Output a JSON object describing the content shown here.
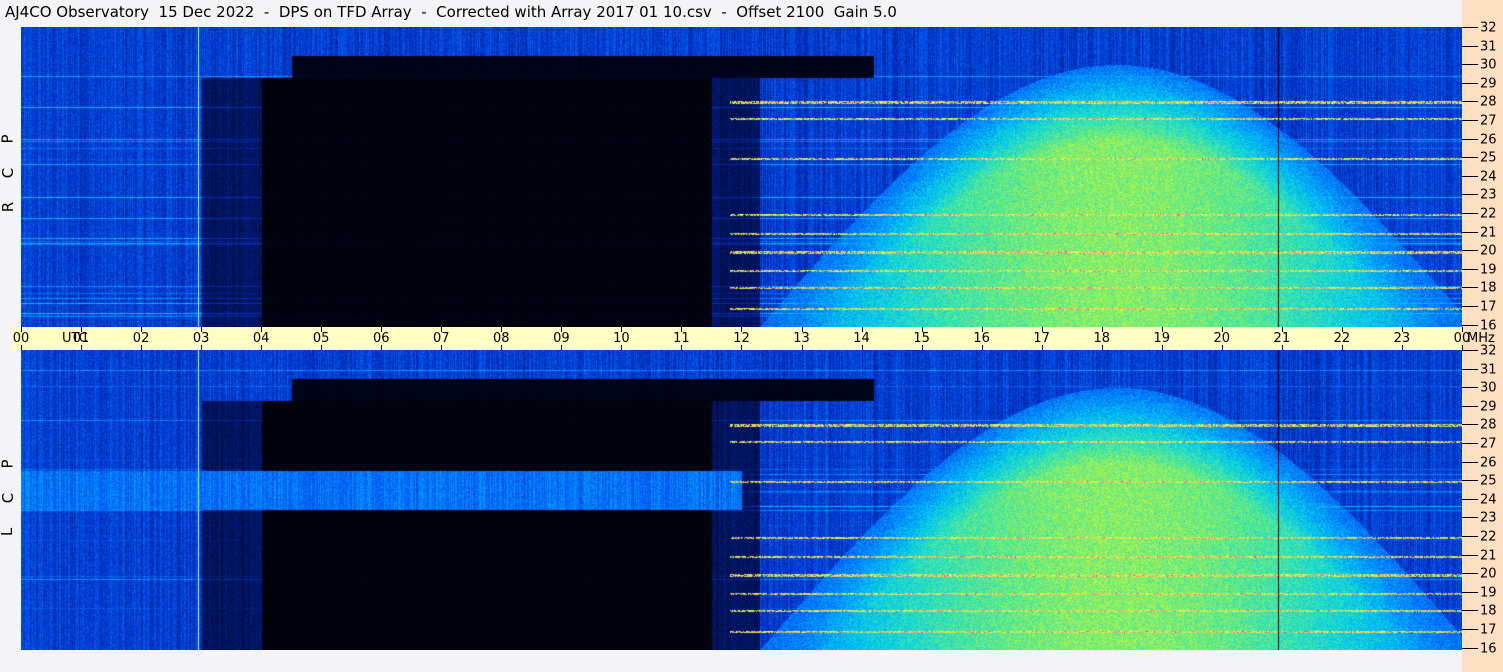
{
  "title": "AJ4CO Observatory  15 Dec 2022  -  DPS on TFD Array  -  Corrected with Array 2017 01 10.csv  -  Offset 2100  Gain 5.0",
  "chart_data": [
    {
      "type": "heatmap",
      "name": "RCP",
      "panel_label": [
        "R",
        "C",
        "P"
      ],
      "x_range_utc_hours": [
        0,
        24
      ],
      "y_range_mhz": [
        16,
        32
      ],
      "features": "quiet black band 03-12 UTC; broadband daytime enhancement 13-24 UTC below ~28 MHz; strong horizontal interference at 27, 25, 21, 20, 18, 17 MHz; bright line near 03 UTC; dark line near 20.9 UTC"
    },
    {
      "type": "heatmap",
      "name": "LCP",
      "panel_label": [
        "L",
        "C",
        "P"
      ],
      "x_range_utc_hours": [
        0,
        24
      ],
      "y_range_mhz": [
        16,
        32
      ],
      "features": "as RCP plus persistent blue band 23.5-25.5 MHz from 00-12 UTC"
    }
  ],
  "time_axis": {
    "labels": [
      "00",
      "01",
      "02",
      "03",
      "04",
      "05",
      "06",
      "07",
      "08",
      "09",
      "10",
      "11",
      "12",
      "13",
      "14",
      "15",
      "16",
      "17",
      "18",
      "19",
      "20",
      "21",
      "22",
      "23",
      "00"
    ],
    "utc_label": "UTC",
    "unit_label": "MHz"
  },
  "freq_axis": {
    "labels": [
      "32",
      "31",
      "30",
      "29",
      "28",
      "27",
      "26",
      "25",
      "24",
      "23",
      "22",
      "21",
      "20",
      "19",
      "18",
      "17",
      "16"
    ]
  },
  "colors": {
    "title_bg": "#f4f4f6",
    "axis_band": "#ffffc4",
    "right_strip": "#fddfc2"
  }
}
